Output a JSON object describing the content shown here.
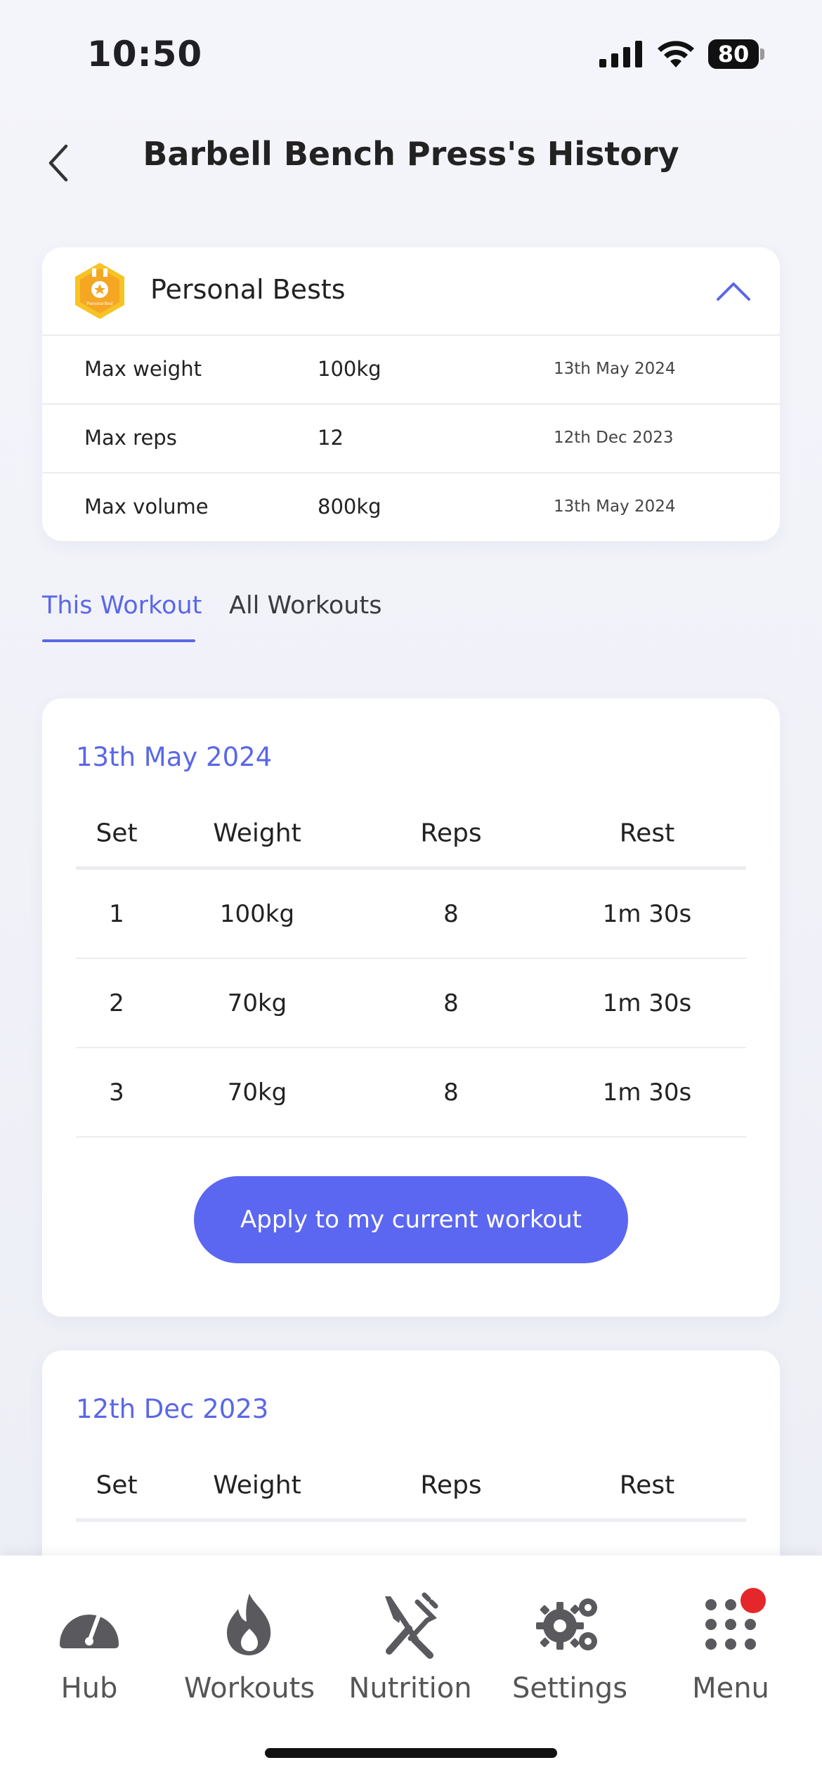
{
  "status_bar": {
    "time": "10:50",
    "battery": "80"
  },
  "header": {
    "title": "Barbell Bench Press's History"
  },
  "personal_bests": {
    "title": "Personal Bests",
    "badge_text": "Personal Best",
    "rows": [
      {
        "label": "Max weight",
        "value": "100kg",
        "date": "13th May 2024"
      },
      {
        "label": "Max reps",
        "value": "12",
        "date": "12th Dec 2023"
      },
      {
        "label": "Max volume",
        "value": "800kg",
        "date": "13th May 2024"
      }
    ]
  },
  "tabs": {
    "this_workout": "This Workout",
    "all_workouts": "All Workouts",
    "active": "this_workout"
  },
  "table_headers": {
    "set": "Set",
    "weight": "Weight",
    "reps": "Reps",
    "rest": "Rest"
  },
  "workouts": [
    {
      "date": "13th May 2024",
      "sets": [
        {
          "set": "1",
          "weight": "100kg",
          "reps": "8",
          "rest": "1m 30s"
        },
        {
          "set": "2",
          "weight": "70kg",
          "reps": "8",
          "rest": "1m 30s"
        },
        {
          "set": "3",
          "weight": "70kg",
          "reps": "8",
          "rest": "1m 30s"
        }
      ],
      "apply_label": "Apply to my current workout"
    },
    {
      "date": "12th Dec 2023"
    }
  ],
  "bottom_nav": {
    "items": [
      {
        "label": "Hub",
        "icon": "gauge-icon"
      },
      {
        "label": "Workouts",
        "icon": "flame-icon"
      },
      {
        "label": "Nutrition",
        "icon": "fork-knife-icon"
      },
      {
        "label": "Settings",
        "icon": "gears-icon"
      },
      {
        "label": "Menu",
        "icon": "grid-dots-icon"
      }
    ]
  },
  "colors": {
    "accent": "#5a67e8",
    "button": "#5b67f0",
    "notification": "#e5262b",
    "badge_gold": "#f5b400"
  }
}
